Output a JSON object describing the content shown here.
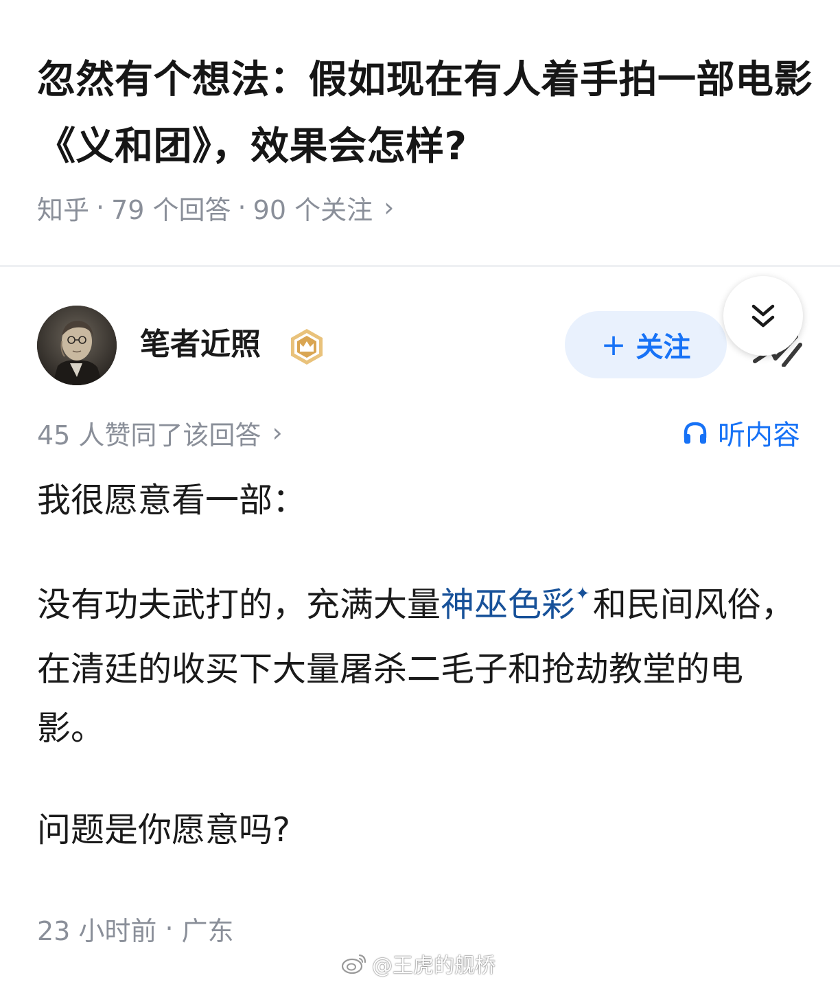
{
  "question": {
    "title": "忽然有个想法：假如现在有人着手拍一部电影《义和团》，效果会怎样?",
    "source": "知乎",
    "answers": "79 个回答",
    "followers": "90 个关注",
    "chevron": "›"
  },
  "author": {
    "name": "笔者近照",
    "badge_icon": "crown-badge-icon",
    "follow_label": "关注",
    "follow_plus": "+",
    "share_icon": "share-icon",
    "collapse_icon": "double-chevron-down-icon"
  },
  "answer": {
    "votes": "45 人赞同了该回答",
    "votes_chevron": "›",
    "listen_label": "听内容",
    "p1": "我很愿意看一部：",
    "p2_before": "没有功夫武打的，充满大量",
    "p2_keyword": "神巫色彩",
    "p2_star": "✦",
    "p2_after": "和民间风俗，在清廷的收买下大量屠杀二毛子和抢劫教堂的电影。",
    "p3": "问题是你愿意吗?",
    "time": "23 小时前",
    "location": "广东"
  },
  "watermark": {
    "text": "@王虎的舰桥"
  },
  "colors": {
    "accent": "#1772f6",
    "keyword": "#175199",
    "meta": "#8a8f99",
    "follow_bg": "#e9f1fd"
  }
}
